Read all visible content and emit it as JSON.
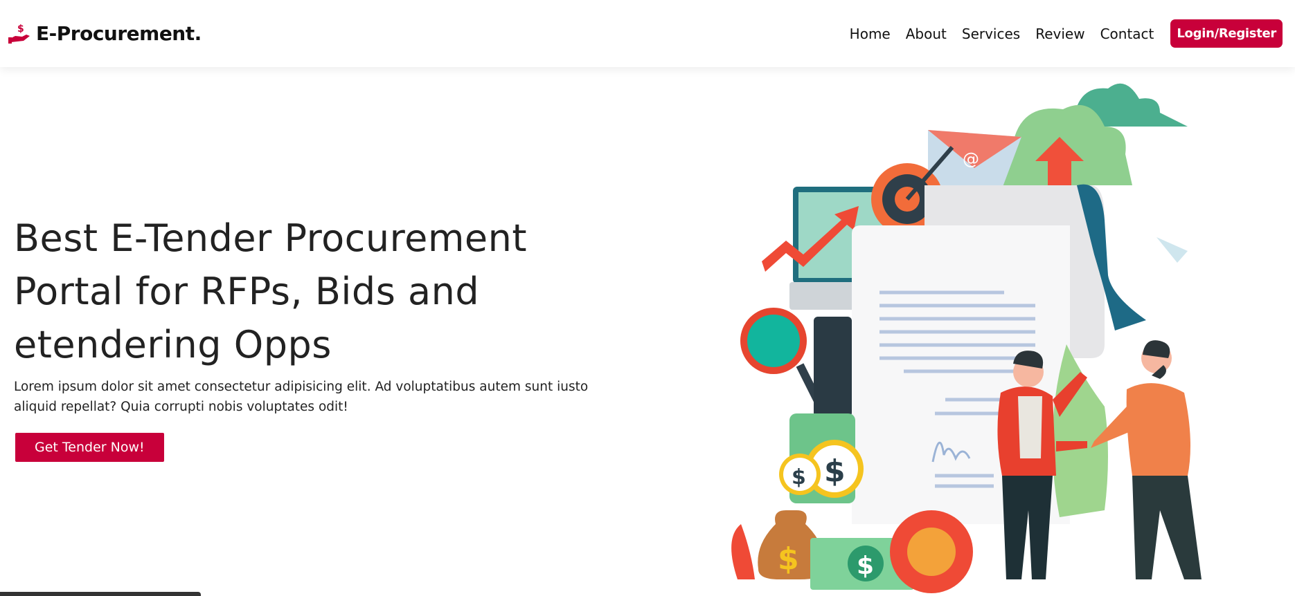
{
  "brand": {
    "name": "E-Procurement.",
    "icon": "hand-dollar-icon",
    "accent": "#c8003a"
  },
  "nav": {
    "items": [
      {
        "label": "Home"
      },
      {
        "label": "About"
      },
      {
        "label": "Services"
      },
      {
        "label": "Review"
      },
      {
        "label": "Contact"
      }
    ],
    "login_label": "Login/Register"
  },
  "hero": {
    "title_prefix": "Best E-Tender ",
    "title_highlight": "Procurement",
    "title_line2": "Portal for RFPs, Bids and",
    "title_line3": "etendering Opps",
    "description": "Lorem ipsum dolor sit amet consectetur adipisicing elit. Ad voluptatibus autem sunt iusto aliquid repellat? Quia corrupti nobis voluptates odit!",
    "cta_label": "Get Tender Now!"
  },
  "illustration": {
    "icon": "procurement-handshake-illustration",
    "coin_symbol": "$"
  }
}
